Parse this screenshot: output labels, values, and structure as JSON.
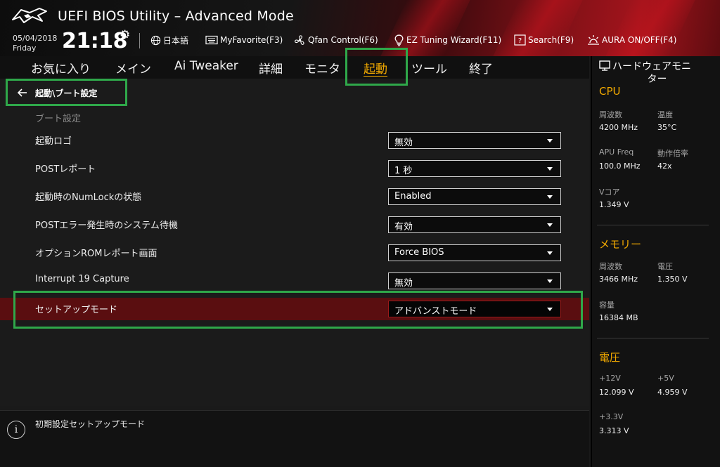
{
  "header": {
    "title": "UEFI BIOS Utility – Advanced Mode",
    "date": "05/04/2018",
    "day": "Friday",
    "time": "21:18",
    "toolbar": {
      "language": "日本語",
      "myfavorite": "MyFavorite(F3)",
      "qfan": "Qfan Control(F6)",
      "ez_tuning": "EZ Tuning Wizard(F11)",
      "search": "Search(F9)",
      "aura": "AURA ON/OFF(F4)"
    }
  },
  "tabs": [
    "お気に入り",
    "メイン",
    "Ai Tweaker",
    "詳細",
    "モニタ",
    "起動",
    "ツール",
    "終了"
  ],
  "active_tab": "起動",
  "breadcrumb": "起動\\ブート設定",
  "section_title": "ブート設定",
  "settings": [
    {
      "label": "起動ロゴ",
      "value": "無効"
    },
    {
      "label": "POSTレポート",
      "value": "1 秒"
    },
    {
      "label": "起動時のNumLockの状態",
      "value": "Enabled"
    },
    {
      "label": "POSTエラー発生時のシステム待機",
      "value": "有効"
    },
    {
      "label": "オプションROMレポート画面",
      "value": "Force BIOS"
    },
    {
      "label": "Interrupt 19 Capture",
      "value": "無効"
    },
    {
      "label": "セットアップモード",
      "value": "アドバンストモード"
    }
  ],
  "help_text": "初期設定セットアップモード",
  "hw_monitor": {
    "title_line1": "ハードウェアモニ",
    "title_line2": "ター",
    "cpu": {
      "heading": "CPU",
      "freq_label": "周波数",
      "freq_value": "4200 MHz",
      "temp_label": "温度",
      "temp_value": "35°C",
      "apu_label": "APU Freq",
      "apu_value": "100.0 MHz",
      "ratio_label": "動作倍率",
      "ratio_value": "42x",
      "vcore_label": "Vコア",
      "vcore_value": "1.349 V"
    },
    "memory": {
      "heading": "メモリー",
      "freq_label": "周波数",
      "freq_value": "3466 MHz",
      "volt_label": "電圧",
      "volt_value": "1.350 V",
      "cap_label": "容量",
      "cap_value": "16384 MB"
    },
    "voltage": {
      "heading": "電圧",
      "v12_label": "+12V",
      "v12_value": "12.099 V",
      "v5_label": "+5V",
      "v5_value": "4.959 V",
      "v33_label": "+3.3V",
      "v33_value": "3.313 V"
    }
  },
  "colors": {
    "accent": "#f0a800",
    "highlight_box": "#2fa84a",
    "selected_row": "#5a0e10",
    "header_red": "#a3141c"
  },
  "icons": {
    "logo": "rog-logo-icon",
    "settings": "gear-icon",
    "language": "globe-icon",
    "favorite": "keyboard-icon",
    "qfan": "fan-icon",
    "tuning": "bulb-icon",
    "search": "search-icon",
    "aura": "aura-icon",
    "back": "arrow-left-icon",
    "info": "info-icon",
    "monitor": "monitor-icon"
  }
}
